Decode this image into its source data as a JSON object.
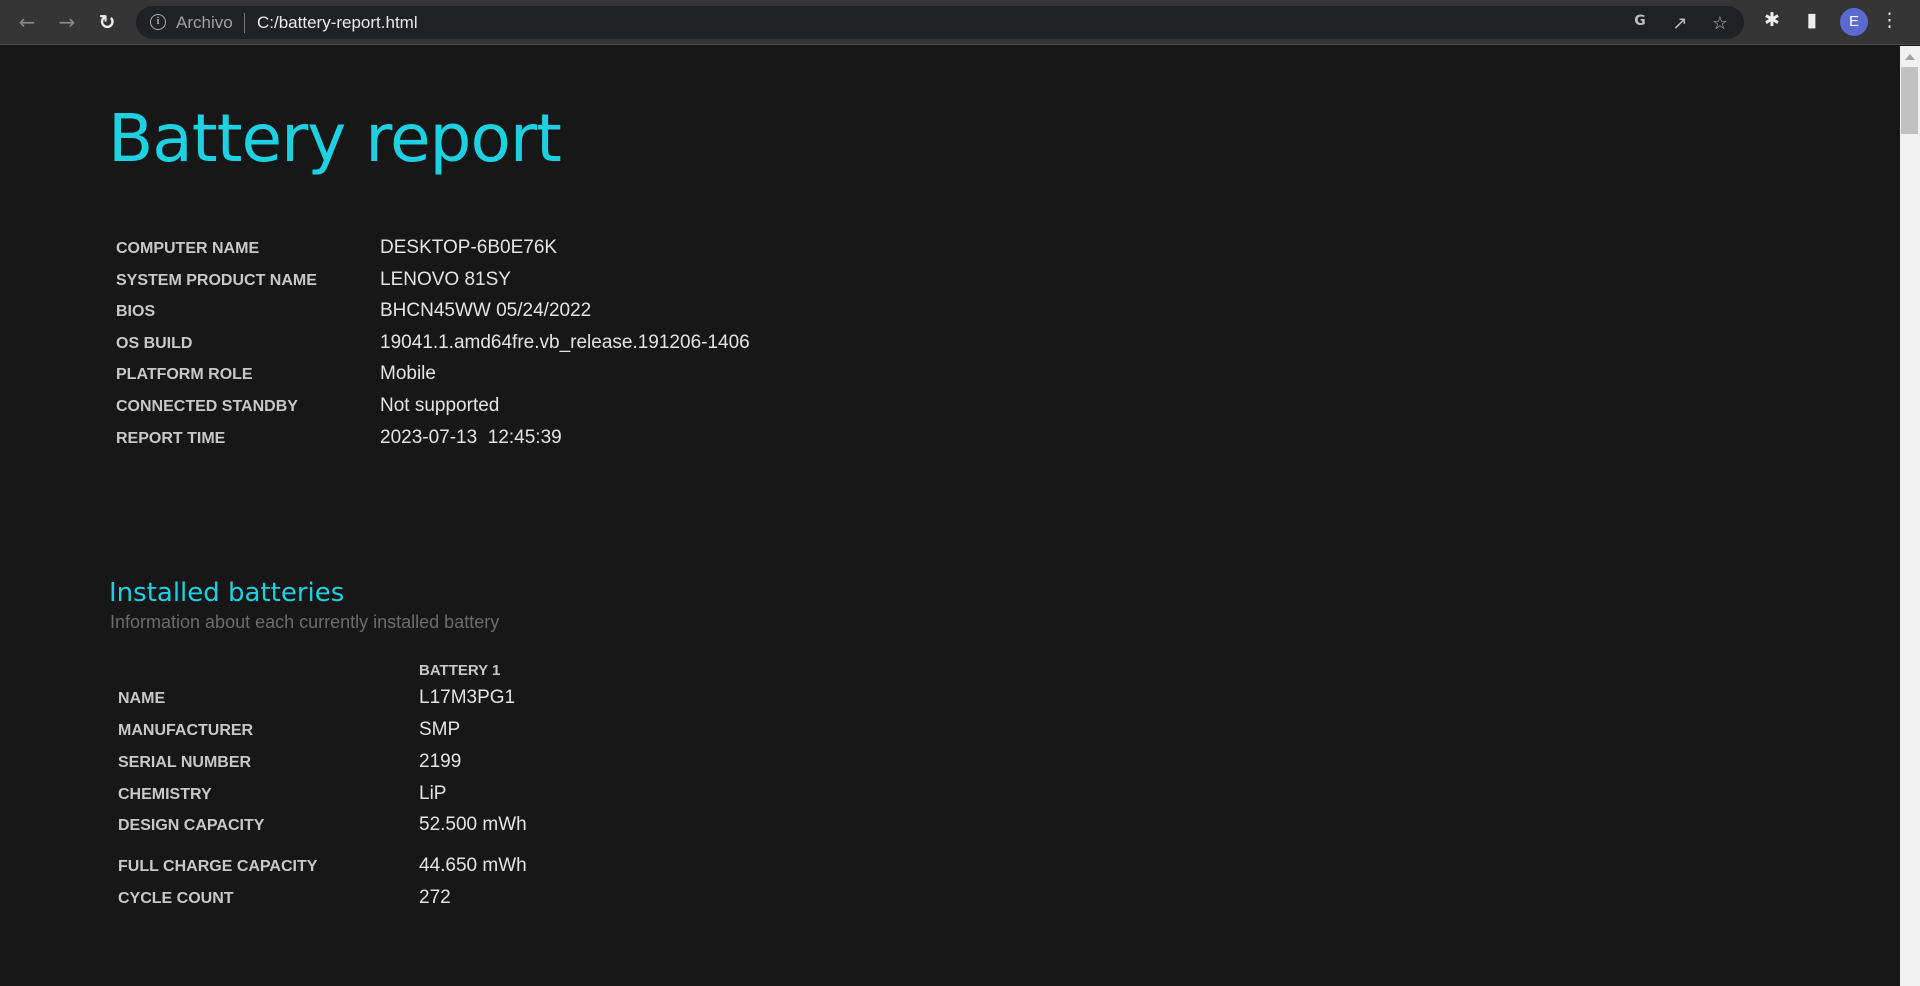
{
  "browser": {
    "scheme_label": "Archivo",
    "url": "C:/battery-report.html",
    "avatar_letter": "E",
    "icons": [
      "back-icon",
      "forward-icon",
      "reload-icon",
      "info-icon",
      "translate-icon",
      "share-icon",
      "star-icon",
      "extensions-icon",
      "side-panel-icon",
      "menu-icon"
    ]
  },
  "report": {
    "title": "Battery report",
    "system_info": [
      {
        "label": "COMPUTER NAME",
        "value": "DESKTOP-6B0E76K"
      },
      {
        "label": "SYSTEM PRODUCT NAME",
        "value": "LENOVO 81SY"
      },
      {
        "label": "BIOS",
        "value": "BHCN45WW 05/24/2022"
      },
      {
        "label": "OS BUILD",
        "value": "19041.1.amd64fre.vb_release.191206-1406"
      },
      {
        "label": "PLATFORM ROLE",
        "value": "Mobile"
      },
      {
        "label": "CONNECTED STANDBY",
        "value": "Not supported"
      },
      {
        "label": "REPORT TIME",
        "value": "2023-07-13  12:45:39"
      }
    ],
    "installed_batteries": {
      "title": "Installed batteries",
      "subtitle": "Information about each currently installed battery",
      "column_header": "BATTERY 1",
      "rows": [
        {
          "label": "NAME",
          "value": "L17M3PG1"
        },
        {
          "label": "MANUFACTURER",
          "value": "SMP"
        },
        {
          "label": "SERIAL NUMBER",
          "value": "2199"
        },
        {
          "label": "CHEMISTRY",
          "value": "LiP"
        },
        {
          "label": "DESIGN CAPACITY",
          "value": "52.500 mWh"
        },
        {
          "label": "FULL CHARGE CAPACITY",
          "value": "44.650 mWh"
        },
        {
          "label": "CYCLE COUNT",
          "value": "272"
        }
      ]
    }
  },
  "colors": {
    "accent": "#1dd1e3",
    "background": "#171717"
  }
}
